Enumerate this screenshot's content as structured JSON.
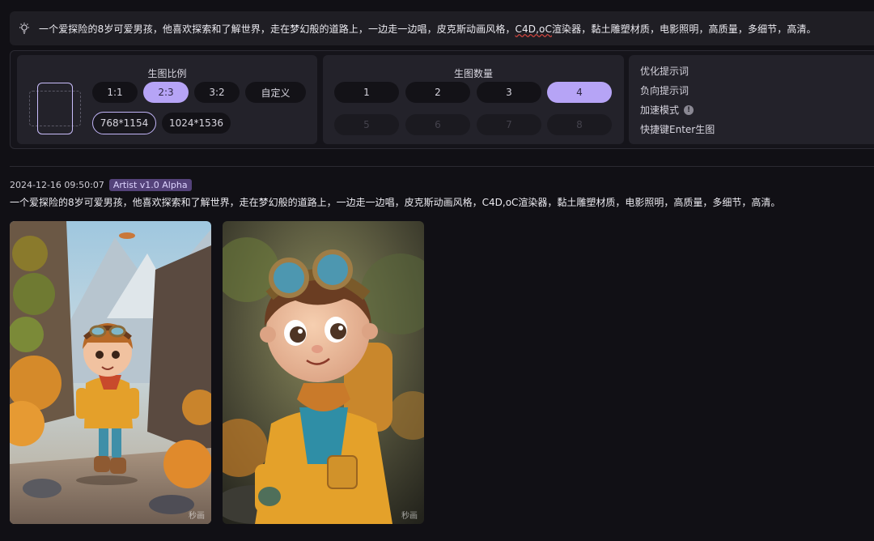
{
  "prompt_bar": {
    "icon": "lightbulb-icon",
    "text_before": "一个爱探险的8岁可爱男孩，他喜欢探索和了解世界，走在梦幻般的道路上，一边走一边唱，皮克斯动画风格，",
    "text_marked": "C4D,oC",
    "text_after": "渲染器，黏土雕塑材质，电影照明，高质量，多细节，高清。"
  },
  "ratio": {
    "title": "生图比例",
    "options": [
      "1:1",
      "2:3",
      "3:2",
      "自定义"
    ],
    "selected": "2:3",
    "sizes": [
      "768*1154",
      "1024*1536"
    ],
    "selected_size": "768*1154"
  },
  "count": {
    "title": "生图数量",
    "options": [
      "1",
      "2",
      "3",
      "4"
    ],
    "selected": "4",
    "disabled_options": [
      "5",
      "6",
      "7",
      "8"
    ]
  },
  "options": {
    "optimize": "优化提示词",
    "negative": "负向提示词",
    "fast_mode": "加速模式",
    "fast_mode_info": "!",
    "shortcut": "快捷键Enter生图"
  },
  "result": {
    "timestamp": "2024-12-16 09:50:07",
    "model": "Artist v1.0 Alpha",
    "prompt": "一个爱探险的8岁可爱男孩，他喜欢探索和了解世界，走在梦幻般的道路上，一边走一边唱，皮克斯动画风格，C4D,oC渲染器，黏土雕塑材质，电影照明，高质量，多细节，高清。",
    "images": [
      {
        "watermark": "秒画"
      },
      {
        "watermark": "秒画"
      }
    ]
  },
  "colors": {
    "accent": "#b6a4f6",
    "badge": "#54427a",
    "background": "#111015",
    "panel": "#23222a"
  }
}
